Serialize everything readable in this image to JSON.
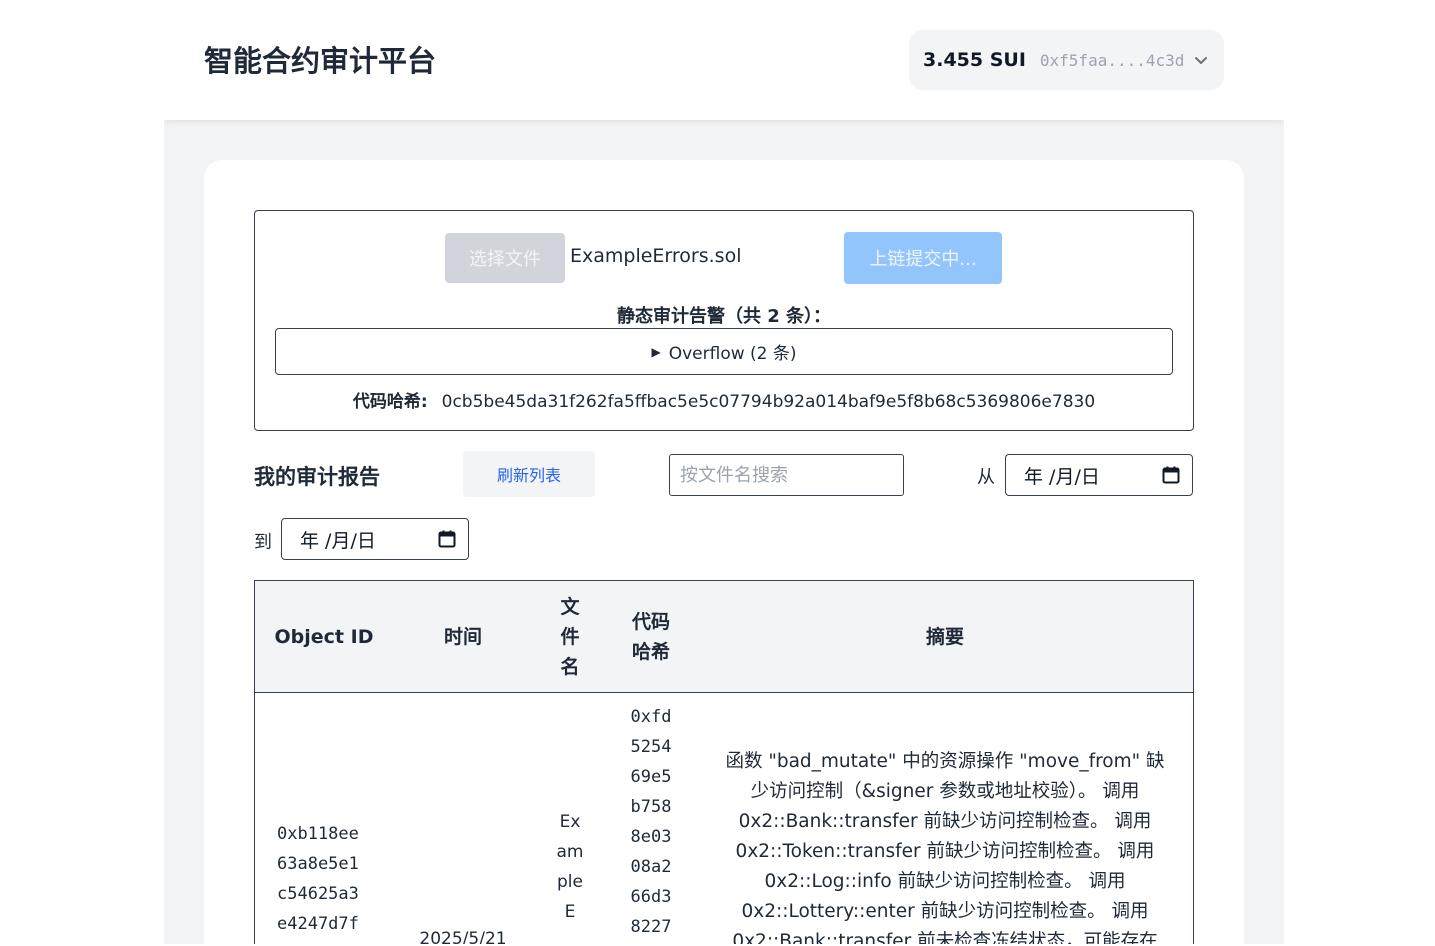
{
  "header": {
    "title": "智能合约审计平台",
    "wallet_balance": "3.455 SUI",
    "wallet_address": "0xf5faa....4c3d"
  },
  "upload": {
    "choose_file_label": "选择文件",
    "file_name": "ExampleErrors.sol",
    "submit_label": "上链提交中...",
    "warnings_title": "静态审计告警（共 2 条）：",
    "warning_group_summary": "Overflow (2 条)",
    "code_hash_label": "代码哈希:",
    "code_hash": "0cb5be45da31f262fa5ffbac5e5c07794b92a014baf9e5f8b68c5369806e7830"
  },
  "reports": {
    "title": "我的审计报告",
    "refresh_label": "刷新列表",
    "search_placeholder": "按文件名搜索",
    "from_label": "从",
    "to_label": "到",
    "date_from_display": "年 /月/日",
    "date_to_display": "年 /月/日"
  },
  "table": {
    "columns": [
      "Object ID",
      "时间",
      "文件名",
      "代码哈希",
      "摘要"
    ],
    "rows": [
      {
        "object_id": "0xb118ee63a8e5e1c54625a3e4247d7f",
        "time": "2025/5/21",
        "file_name": "ExampleE",
        "code_hash": "0xfd525469e5b7588e0308a266d38227",
        "summary": "函数 \"bad_mutate\" 中的资源操作 \"move_from\" 缺少访问控制（&signer 参数或地址校验）。 调用 0x2::Bank::transfer 前缺少访问控制检查。 调用 0x2::Token::transfer 前缺少访问控制检查。 调用 0x2::Log::info 前缺少访问控制检查。 调用 0x2::Lottery::enter 前缺少访问控制检查。 调用 0x2::Bank::transfer 前未检查冻结状态，可能存在"
      }
    ]
  }
}
